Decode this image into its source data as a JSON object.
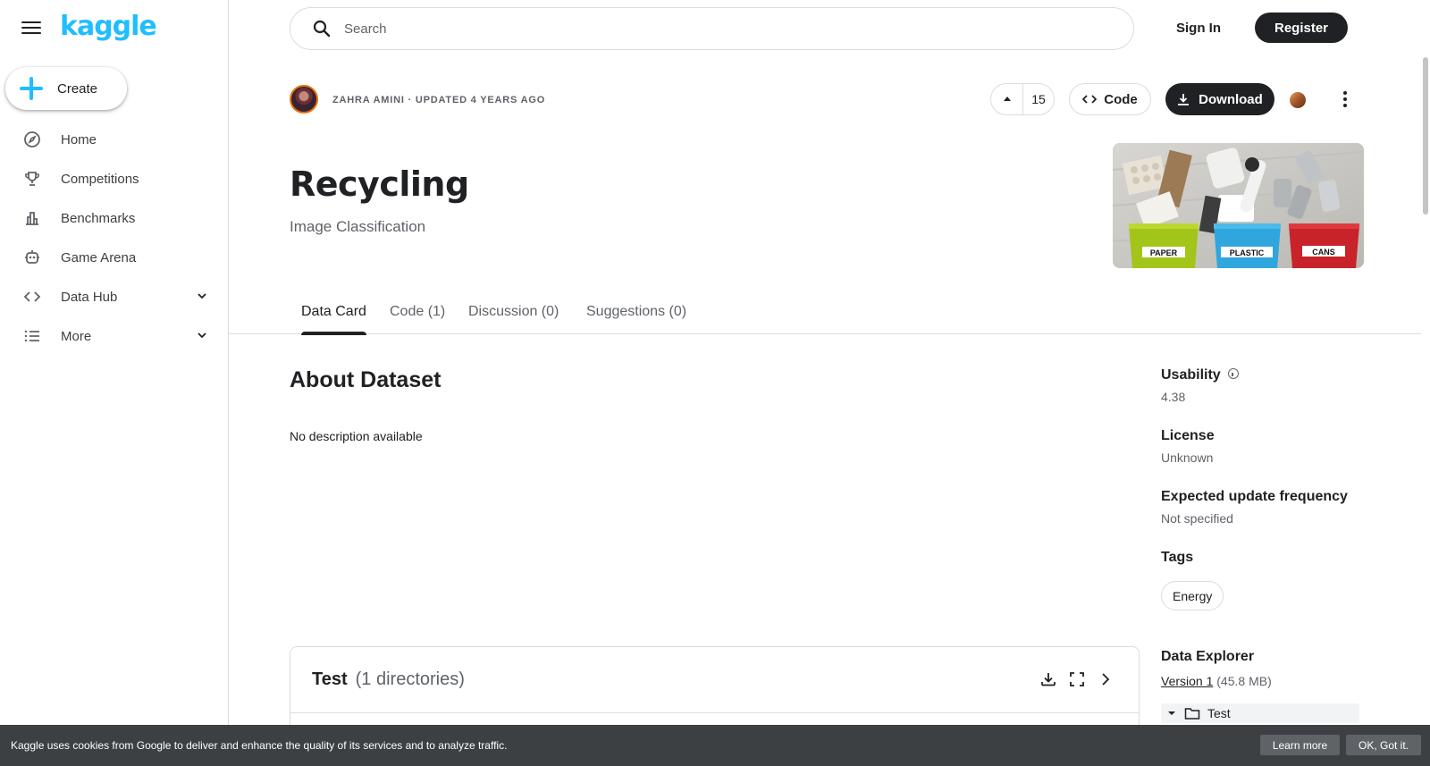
{
  "brand": {
    "logo_text": "kaggle",
    "accent": "#20beff"
  },
  "sidebar": {
    "create_label": "Create",
    "items": [
      {
        "label": "Home",
        "icon": "compass-icon"
      },
      {
        "label": "Competitions",
        "icon": "trophy-icon"
      },
      {
        "label": "Benchmarks",
        "icon": "bar-chart-icon"
      },
      {
        "label": "Game Arena",
        "icon": "robot-icon"
      },
      {
        "label": "Data Hub",
        "icon": "code-icon",
        "expandable": true
      },
      {
        "label": "More",
        "icon": "list-icon",
        "expandable": true
      }
    ]
  },
  "topbar": {
    "search_placeholder": "Search",
    "signin_label": "Sign In",
    "register_label": "Register"
  },
  "dataset": {
    "byline": "ZAHRA AMINI · UPDATED 4 YEARS AGO",
    "vote_count": "15",
    "code_label": "Code",
    "download_label": "Download",
    "title": "Recycling",
    "subtitle": "Image Classification",
    "banner_labels": {
      "paper": "PAPER",
      "plastic": "PLASTIC",
      "cans": "CANS"
    }
  },
  "tabs": [
    {
      "label": "Data Card",
      "active": true
    },
    {
      "label": "Code (1)",
      "active": false
    },
    {
      "label": "Discussion (0)",
      "active": false
    },
    {
      "label": "Suggestions (0)",
      "active": false
    }
  ],
  "about": {
    "title": "About Dataset",
    "description": "No description available"
  },
  "meta": {
    "usability_label": "Usability",
    "usability_value": "4.38",
    "license_label": "License",
    "license_value": "Unknown",
    "frequency_label": "Expected update frequency",
    "frequency_value": "Not specified",
    "tags_label": "Tags",
    "tags": [
      "Energy"
    ],
    "explorer_label": "Data Explorer",
    "version_link": "Version 1",
    "version_size": "(45.8 MB)",
    "tree_root": "Test"
  },
  "test_card": {
    "title": "Test",
    "count": "(1 directories)"
  },
  "cookie": {
    "text": "Kaggle uses cookies from Google to deliver and enhance the quality of its services and to analyze traffic.",
    "learn_more": "Learn more",
    "ok": "OK, Got it."
  }
}
